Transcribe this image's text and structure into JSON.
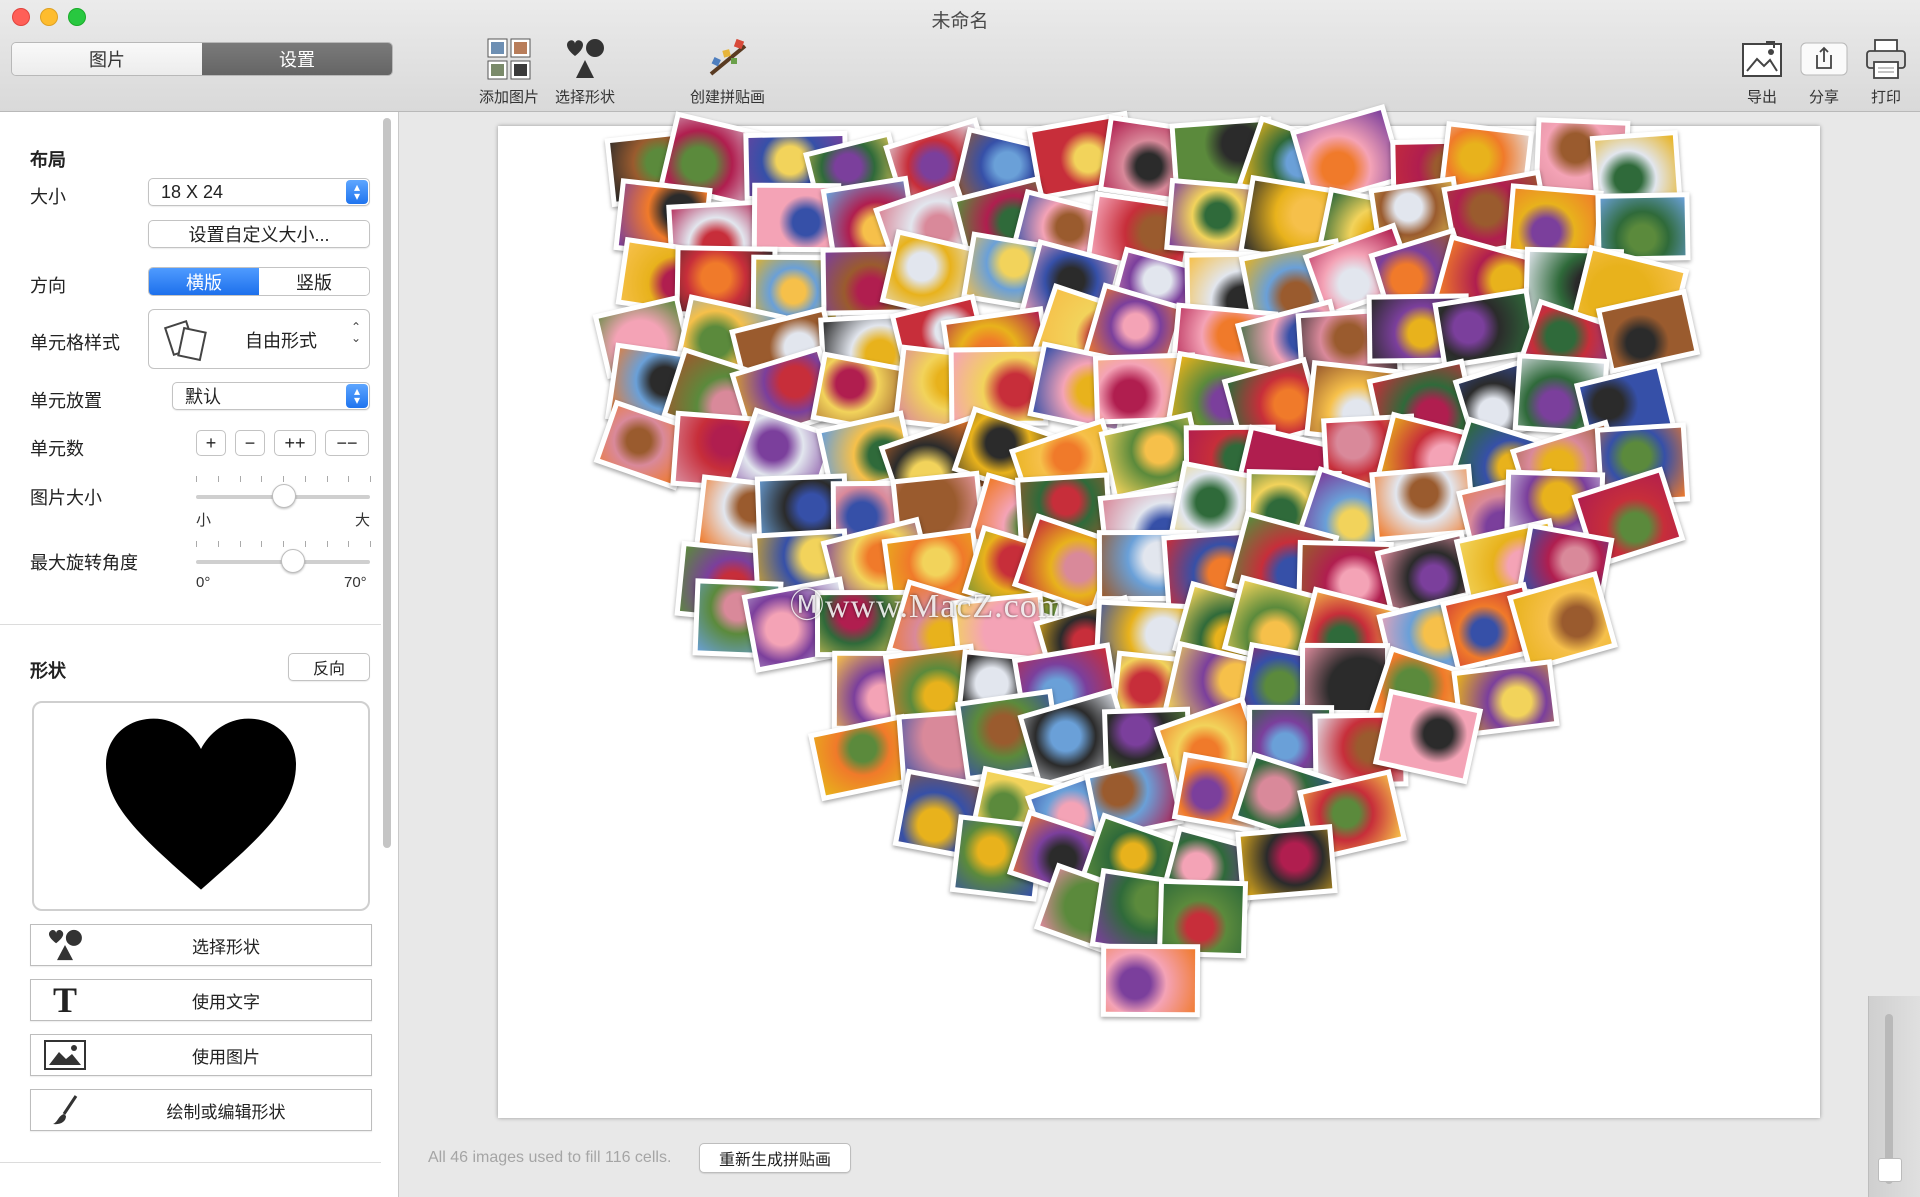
{
  "window": {
    "title": "未命名"
  },
  "top_segment": {
    "tabs": [
      "图片",
      "设置"
    ],
    "selected": "设置"
  },
  "toolbar": {
    "add_photos": "添加图片",
    "choose_shape": "选择形状",
    "create_collage": "创建拼贴画",
    "export": "导出",
    "share": "分享",
    "print": "打印"
  },
  "layout": {
    "title": "布局",
    "size_label": "大小",
    "size_value": "18 X 24",
    "custom_size_button": "设置自定义大小...",
    "orientation_label": "方向",
    "orientation_options": [
      "横版",
      "竖版"
    ],
    "orientation_selected": "横版",
    "cell_style_label": "单元格样式",
    "cell_style_value": "自由形式",
    "cell_placement_label": "单元放置",
    "cell_placement_value": "默认",
    "cell_count_label": "单元数",
    "cell_count_buttons": [
      "+",
      "−",
      "++",
      "−−"
    ],
    "image_size_label": "图片大小",
    "image_size_min": "小",
    "image_size_max": "大",
    "image_size_level": 0.5,
    "max_rotation_label": "最大旋转角度",
    "rotation_min": "0°",
    "rotation_max": "70°",
    "rotation_level": 0.55
  },
  "shape": {
    "title": "形状",
    "reverse_button": "反向",
    "current_shape": "heart",
    "choose_shape_button": "选择形状",
    "use_text_button": "使用文字",
    "use_image_button": "使用图片",
    "draw_edit_button": "绘制或编辑形状"
  },
  "canvas": {
    "watermark": "Ⓜwww.MacZ.com",
    "status": "All 46 images used to fill 116 cells.",
    "regenerate_button": "重新生成拼贴画"
  },
  "colors": {
    "accent": "#1f74ef",
    "photo_palette": [
      "#e8b21c",
      "#c72e3a",
      "#7b3f9c",
      "#f07a2a",
      "#2f6a3a",
      "#d9899a",
      "#3650a8",
      "#f2d35b",
      "#9a5b2e",
      "#e2e6ee",
      "#b01e4f",
      "#5b8a3c",
      "#f4a3b6",
      "#2b2b2b",
      "#f6c04a",
      "#6aa0d8"
    ]
  }
}
